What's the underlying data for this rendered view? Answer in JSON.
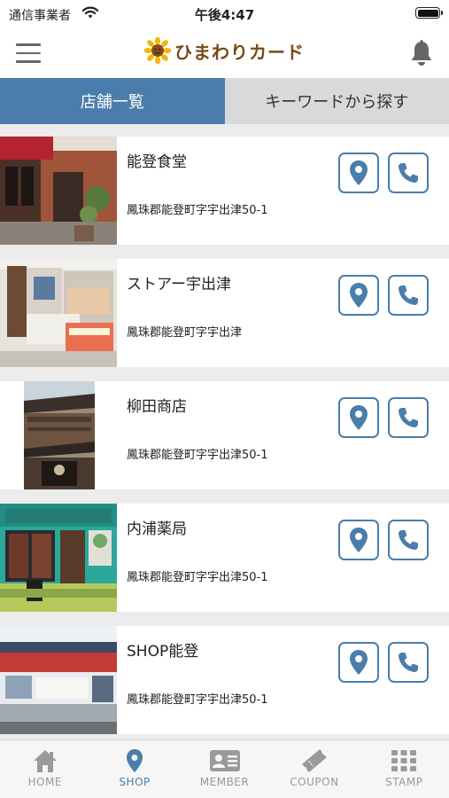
{
  "status_bar": {
    "carrier": "通信事業者",
    "time": "午後4:47"
  },
  "header": {
    "logo_text": "ひまわりカード",
    "menu_icon": "hamburger-menu-icon",
    "bell_icon": "bell-icon"
  },
  "tabs": [
    {
      "label": "店舗一覧",
      "active": true
    },
    {
      "label": "キーワードから探す",
      "active": false
    }
  ],
  "shops": [
    {
      "name": "能登食堂",
      "address": "鳳珠郡能登町字宇出津50-1"
    },
    {
      "name": "ストアー宇出津",
      "address": "鳳珠郡能登町字宇出津"
    },
    {
      "name": "柳田商店",
      "address": "鳳珠郡能登町字宇出津50-1"
    },
    {
      "name": "内浦薬局",
      "address": "鳳珠郡能登町字宇出津50-1"
    },
    {
      "name": "SHOP能登",
      "address": "鳳珠郡能登町字宇出津50-1"
    }
  ],
  "bottom_nav": [
    {
      "label": "HOME",
      "icon": "home-icon",
      "active": false
    },
    {
      "label": "SHOP",
      "icon": "map-pin-icon",
      "active": true
    },
    {
      "label": "MEMBER",
      "icon": "member-card-icon",
      "active": false
    },
    {
      "label": "COUPON",
      "icon": "ticket-icon",
      "active": false
    },
    {
      "label": "STAMP",
      "icon": "grid-icon",
      "active": false
    }
  ],
  "colors": {
    "accent": "#4a7dab",
    "tab_inactive": "#d9d9d9",
    "list_bg": "#ececec"
  }
}
